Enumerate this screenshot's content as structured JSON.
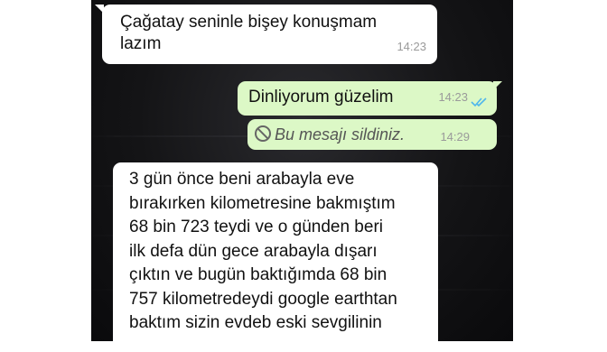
{
  "messages": [
    {
      "direction": "incoming",
      "text_lines": [
        "Çağatay seninle bişey konuşmam",
        "lazım"
      ],
      "time": "14:23"
    },
    {
      "direction": "outgoing",
      "text": "Dinliyorum güzelim",
      "time": "14:23",
      "status": "read"
    },
    {
      "direction": "outgoing",
      "deleted": true,
      "text": "Bu mesajı sildiniz.",
      "time": "14:29"
    },
    {
      "direction": "incoming",
      "text_lines": [
        "3 gün önce beni arabayla eve",
        "bırakırken kilometresine bakmıştım",
        "68 bin 723 teydi ve o günden beri",
        "ilk defa dün gece arabayla dışarı",
        "çıktın ve bugün baktığımda 68 bin",
        "757 kilometredeydi google earthtan",
        "baktım sizin evdeb eski sevgilinin"
      ]
    }
  ],
  "colors": {
    "incoming": "#ffffff",
    "outgoing": "#dcf8c6",
    "read_ticks": "#4fb6ec"
  },
  "icons": {
    "deleted": "prohibited-icon",
    "read": "double-check-icon"
  }
}
